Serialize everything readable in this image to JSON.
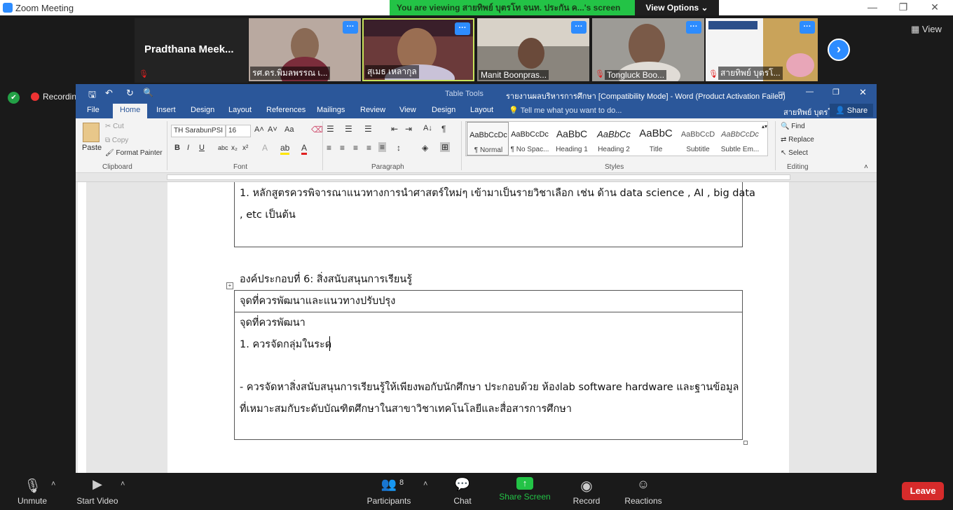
{
  "app": {
    "title": "Zoom Meeting"
  },
  "banner": {
    "text": "You are viewing สายทิพย์ บุตรโท จนท. ประกัน ค...'s screen",
    "view_options": "View Options ⌄"
  },
  "gallery": {
    "active_name": "Pradthana  Meek...",
    "tiles": [
      {
        "name": "รศ.ดร.พิมลพรรณ เ..."
      },
      {
        "name": "สุเมธ เหลากุล"
      },
      {
        "name": "Manit Boonpras..."
      },
      {
        "name": "Tongluck Boo..."
      },
      {
        "name": "สายทิพย์ บุตรโ..."
      }
    ],
    "view_label": "View"
  },
  "recording": {
    "label": "Recording"
  },
  "word": {
    "qat_label": "Table Tools",
    "doc_title": "รายงานผลบริหารการศึกษา [Compatibility Mode] - Word (Product Activation Failed)",
    "user": "สายทิพย์ บุตรโท",
    "share": "Share",
    "tell_me": "Tell me what you want to do...",
    "tabs": [
      "File",
      "Home",
      "Insert",
      "Design",
      "Layout",
      "References",
      "Mailings",
      "Review",
      "View",
      "Design",
      "Layout"
    ],
    "clipboard": {
      "paste": "Paste",
      "cut": "Cut",
      "copy": "Copy",
      "format_painter": "Format Painter",
      "group": "Clipboard"
    },
    "font": {
      "name": "TH SarabunPSI",
      "size": "16",
      "group": "Font"
    },
    "paragraph_group": "Paragraph",
    "styles_group": "Styles",
    "styles": [
      {
        "sample": "AaBbCcDc",
        "name": "¶ Normal"
      },
      {
        "sample": "AaBbCcDc",
        "name": "¶ No Spac..."
      },
      {
        "sample": "AaBbC",
        "name": "Heading 1"
      },
      {
        "sample": "AaBbCc",
        "name": "Heading 2"
      },
      {
        "sample": "AaBbC",
        "name": "Title"
      },
      {
        "sample": "AaBbCcD",
        "name": "Subtitle"
      },
      {
        "sample": "AaBbCcDc",
        "name": "Subtle Em..."
      }
    ],
    "editing": {
      "find": "Find",
      "replace": "Replace",
      "select": "Select",
      "group": "Editing"
    }
  },
  "doc": {
    "line1": "1. หลักสูตรควรพิจารณาแนวทางการนำศาสตร์ใหม่ๆ เข้ามาเป็นรายวิชาเลือก เช่น ด้าน data science , AI , big data",
    "line2": ", etc เป็นต้น",
    "heading": "องค์ประกอบที่ 6: สิ่งสนับสนุนการเรียนรู้",
    "table_header": "จุดที่ควรพัฒนาและแนวทางปรับปรุง",
    "cell_line1": "จุดที่ควรพัฒนา",
    "cell_line2": "1. ควรจัดกลุ่มในระด",
    "cell_line3": "- ควรจัดหาสิ่งสนับสนุนการเรียนรู้ให้เพียงพอกับนักศึกษา ประกอบด้วย ห้องlab software hardware และฐานข้อมูล",
    "cell_line4": "ที่เหมาะสมกับระดับบัณฑิตศึกษาในสาขาวิชาเทคโนโลยีและสื่อสารการศึกษา"
  },
  "toolbar": {
    "unmute": "Unmute",
    "start_video": "Start Video",
    "participants": "Participants",
    "participants_count": "8",
    "chat": "Chat",
    "share_screen": "Share Screen",
    "record": "Record",
    "reactions": "Reactions",
    "leave": "Leave"
  }
}
